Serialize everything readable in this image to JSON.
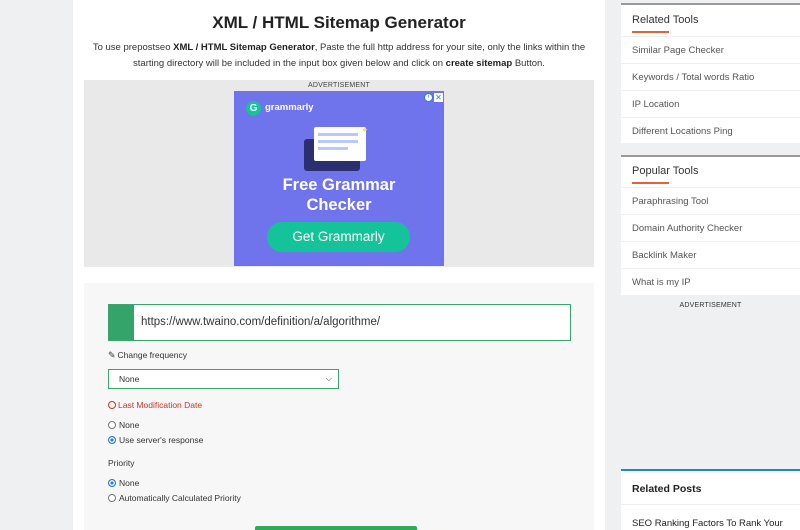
{
  "main": {
    "title": "XML / HTML Sitemap Generator",
    "intro": {
      "part1": "To use prepostseo ",
      "tool_name": "XML / HTML Sitemap Generator",
      "part2": ", Paste the full http address for your site, only the links within the starting directory will be included in the input box given below and click on ",
      "action": "create sitemap",
      "part3": " Button."
    },
    "ad": {
      "label": "ADVERTISEMENT",
      "brand": "grammarly",
      "logo_letter": "G",
      "headline_line1": "Free Grammar",
      "headline_line2": "Checker",
      "cta": "Get Grammarly",
      "bg_color": "#6f73ec",
      "cta_color": "#15c39a"
    }
  },
  "form": {
    "url_value": "https://www.twaino.com/definition/a/algorithme/",
    "change_frequency_label": "Change frequency",
    "change_frequency_value": "None",
    "last_mod_label": "Last Modification Date",
    "last_mod_options": [
      {
        "label": "None",
        "checked": false
      },
      {
        "label": "Use server's response",
        "checked": true
      }
    ],
    "priority_label": "Priority",
    "priority_options": [
      {
        "label": "None",
        "checked": true
      },
      {
        "label": "Automatically Calculated Priority",
        "checked": false
      }
    ],
    "accent_color": "#35a46a"
  },
  "sidebar": {
    "related_tools": {
      "title": "Related Tools",
      "items": [
        "Similar Page Checker",
        "Keywords / Total words Ratio",
        "IP Location",
        "Different Locations Ping"
      ]
    },
    "popular_tools": {
      "title": "Popular Tools",
      "items": [
        "Paraphrasing Tool",
        "Domain Authority Checker",
        "Backlink Maker",
        "What is my IP"
      ]
    },
    "ad_label": "ADVERTISEMENT",
    "related_posts": {
      "title": "Related Posts",
      "first_post": "SEO Ranking Factors To Rank Your"
    }
  },
  "icons": {
    "edit": "edit-icon",
    "clock": "clock-icon",
    "chevron": "chevron-down-icon",
    "ad_info": "ad-info-icon",
    "ad_close": "ad-close-icon"
  }
}
